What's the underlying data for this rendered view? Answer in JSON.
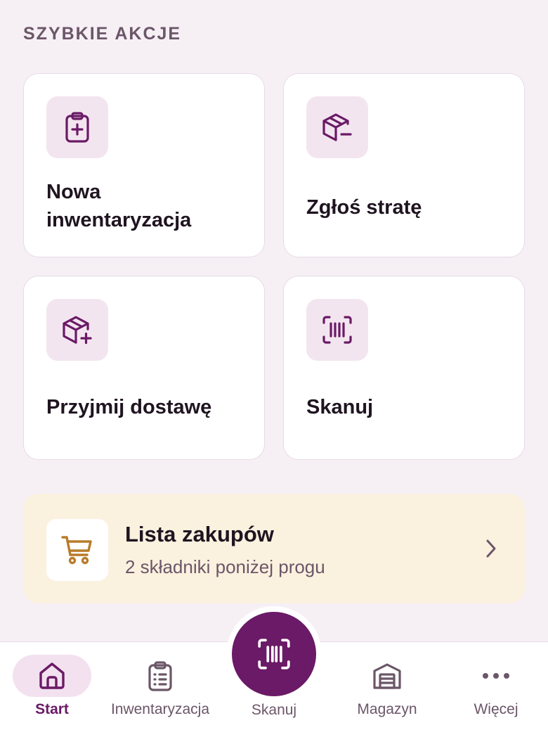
{
  "section_title": "SZYBKIE AKCJE",
  "quick_actions": [
    {
      "label": "Nowa inwentaryzacja",
      "icon": "clipboard-plus-icon"
    },
    {
      "label": "Zgłoś stratę",
      "icon": "box-minus-icon"
    },
    {
      "label": "Przyjmij dostawę",
      "icon": "box-plus-icon"
    },
    {
      "label": "Skanuj",
      "icon": "barcode-scan-icon"
    }
  ],
  "shopping_banner": {
    "title": "Lista zakupów",
    "subtitle": "2 składniki poniżej progu",
    "icon": "cart-icon"
  },
  "bottom_nav": {
    "items": [
      {
        "label": "Start",
        "icon": "home-icon",
        "active": true
      },
      {
        "label": "Inwentaryzacja",
        "icon": "clipboard-list-icon",
        "active": false
      },
      {
        "label": "Skanuj",
        "icon": "barcode-scan-icon",
        "active": false
      },
      {
        "label": "Magazyn",
        "icon": "warehouse-icon",
        "active": false
      },
      {
        "label": "Więcej",
        "icon": "more-dots-icon",
        "active": false
      }
    ]
  },
  "colors": {
    "background": "#f6f0f5",
    "accent": "#6a1a66",
    "icon_tile": "#f3e5f0",
    "banner_bg": "#fbf1df",
    "cart_icon": "#b87b2a",
    "muted_text": "#6b5668"
  }
}
